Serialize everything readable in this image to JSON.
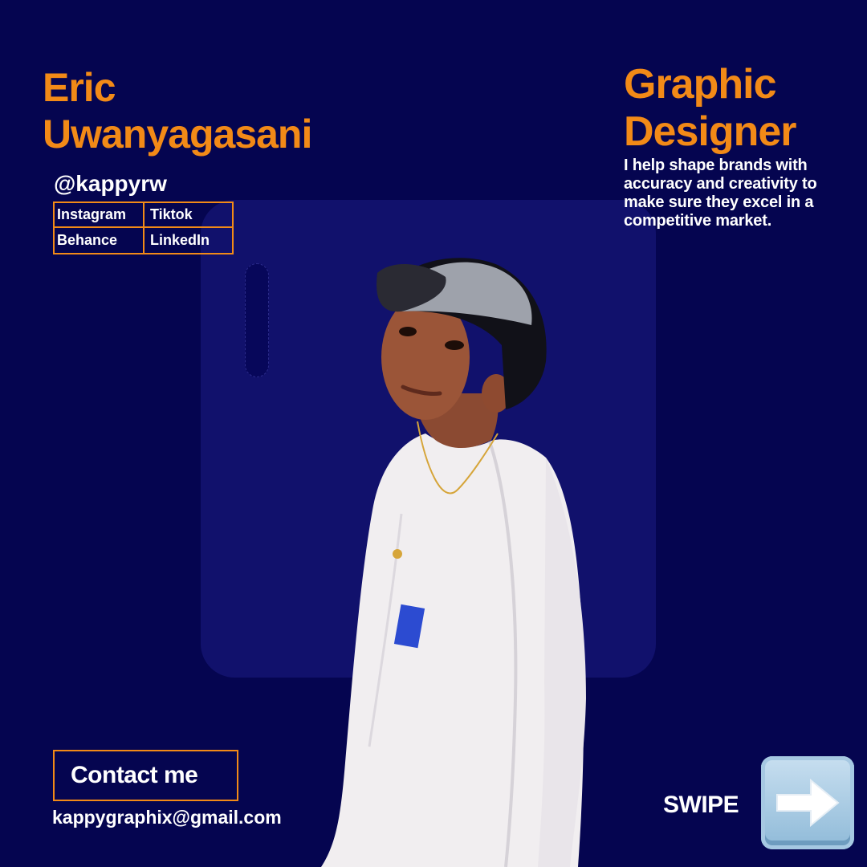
{
  "profile": {
    "first_name": "Eric",
    "last_name": "Uwanyagasani",
    "role_line1": "Graphic",
    "role_line2": "Designer",
    "tagline": "I help shape brands with accuracy and creativity to make sure they excel in a competitive market.",
    "handle": "@kappyrw"
  },
  "social": {
    "items": [
      {
        "label": "Instagram"
      },
      {
        "label": "Tiktok"
      },
      {
        "label": "Behance"
      },
      {
        "label": "LinkedIn"
      }
    ]
  },
  "contact": {
    "button_label": "Contact me",
    "email": "kappygraphix@gmail.com"
  },
  "swipe": {
    "label": "SWIPE",
    "icon": "right-arrow-icon"
  },
  "colors": {
    "background": "#050550",
    "panel": "#11116c",
    "accent": "#f28a17",
    "text": "#ffffff"
  }
}
